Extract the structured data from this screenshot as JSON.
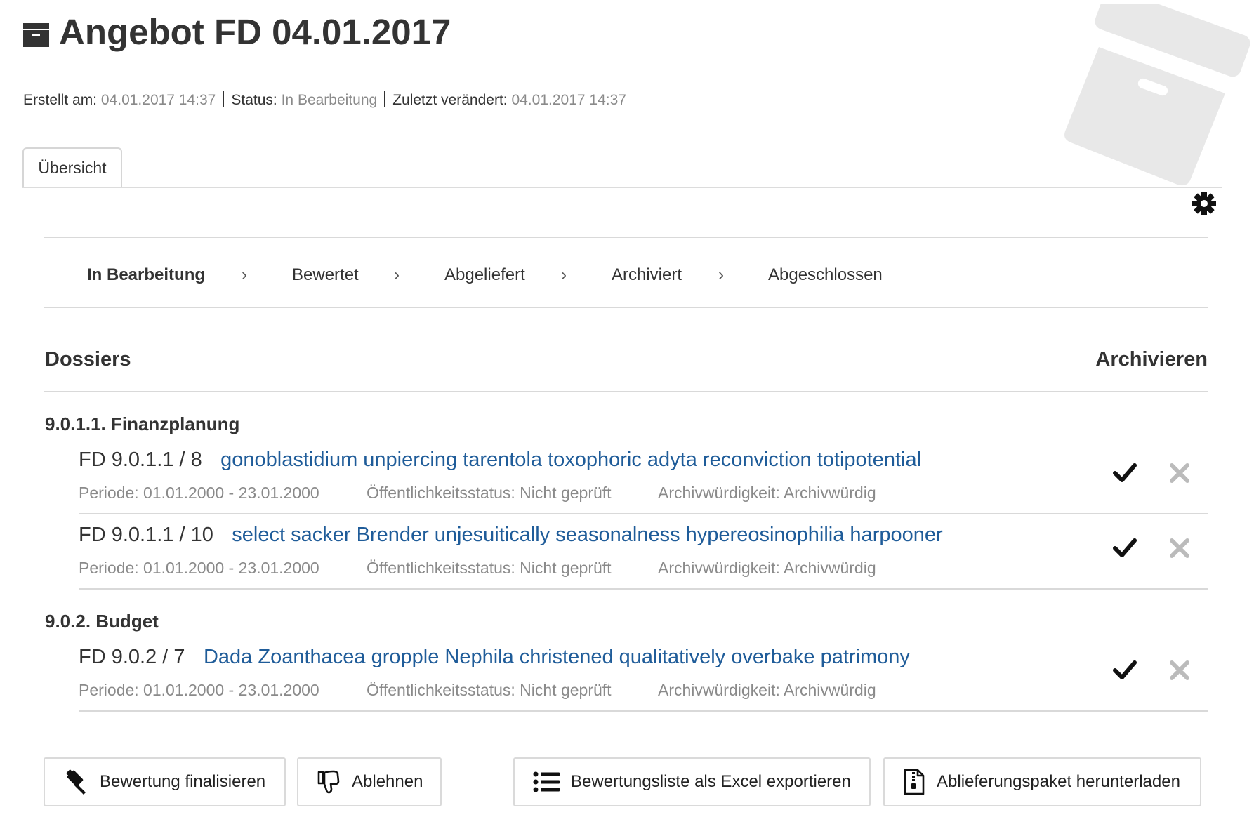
{
  "header": {
    "title": "Angebot FD 04.01.2017",
    "created_label": "Erstellt am:",
    "created_value": "04.01.2017 14:37",
    "status_label": "Status:",
    "status_value": "In Bearbeitung",
    "modified_label": "Zuletzt verändert:",
    "modified_value": "04.01.2017 14:37"
  },
  "tabs": [
    {
      "label": "Übersicht"
    }
  ],
  "workflow": {
    "steps": [
      {
        "label": "In Bearbeitung"
      },
      {
        "label": "Bewertet"
      },
      {
        "label": "Abgeliefert"
      },
      {
        "label": "Archiviert"
      },
      {
        "label": "Abgeschlossen"
      }
    ],
    "separator": "›"
  },
  "dossiers": {
    "title": "Dossiers",
    "archive_column": "Archivieren",
    "groups": [
      {
        "title": "9.0.1.1. Finanzplanung",
        "items": [
          {
            "ref": "FD 9.0.1.1 / 8",
            "title": "gonoblastidium unpiercing tarentola toxophoric adyta reconviction totipotential",
            "period": "Periode: 01.01.2000 - 23.01.2000",
            "public_status": "Öffentlichkeitsstatus: Nicht geprüft",
            "archival": "Archivwürdigkeit: Archivwürdig"
          },
          {
            "ref": "FD 9.0.1.1 / 10",
            "title": "select sacker Brender unjesuitically seasonalness hypereosinophilia harpooner",
            "period": "Periode: 01.01.2000 - 23.01.2000",
            "public_status": "Öffentlichkeitsstatus: Nicht geprüft",
            "archival": "Archivwürdigkeit: Archivwürdig"
          }
        ]
      },
      {
        "title": "9.0.2. Budget",
        "items": [
          {
            "ref": "FD 9.0.2 / 7",
            "title": "Dada Zoanthacea gropple Nephila christened qualitatively overbake patrimony",
            "period": "Periode: 01.01.2000 - 23.01.2000",
            "public_status": "Öffentlichkeitsstatus: Nicht geprüft",
            "archival": "Archivwürdigkeit: Archivwürdig"
          }
        ]
      }
    ]
  },
  "actions": {
    "finalize": "Bewertung finalisieren",
    "reject": "Ablehnen",
    "export_excel": "Bewertungsliste als Excel exportieren",
    "download_package": "Ablieferungspaket herunterladen"
  },
  "icons": {
    "title": "archive-box-icon",
    "settings": "gear-icon",
    "accept": "check-icon",
    "decline": "close-icon",
    "finalize": "gavel-icon",
    "reject": "thumbs-down-icon",
    "export": "list-icon",
    "download": "zip-file-icon"
  },
  "colors": {
    "link": "#1f5c99",
    "muted": "#8a8a8a",
    "text": "#333333",
    "border": "#d9d9d9"
  }
}
